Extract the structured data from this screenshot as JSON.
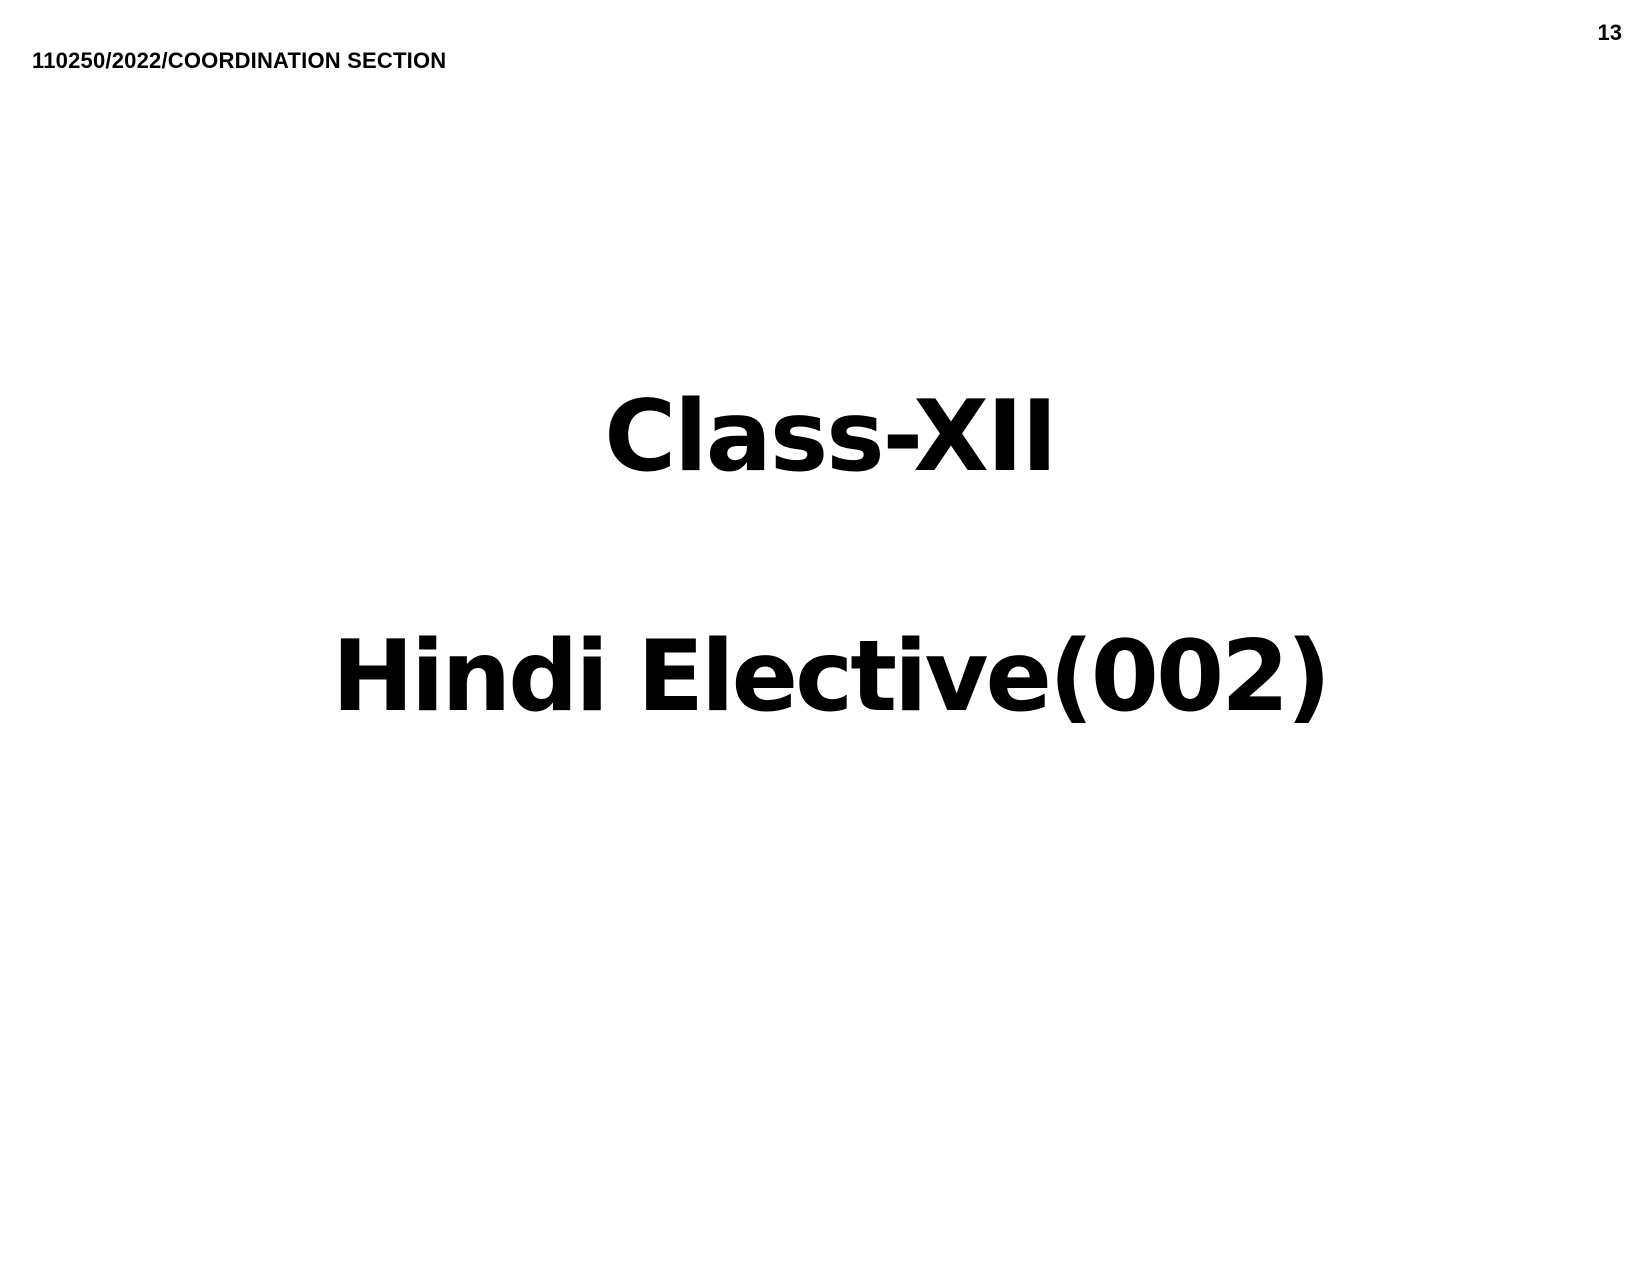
{
  "header": {
    "reference": "110250/2022/COORDINATION SECTION",
    "page_number": "13"
  },
  "content": {
    "class_title": "Class-XII",
    "subject_title": "Hindi Elective(002)"
  }
}
